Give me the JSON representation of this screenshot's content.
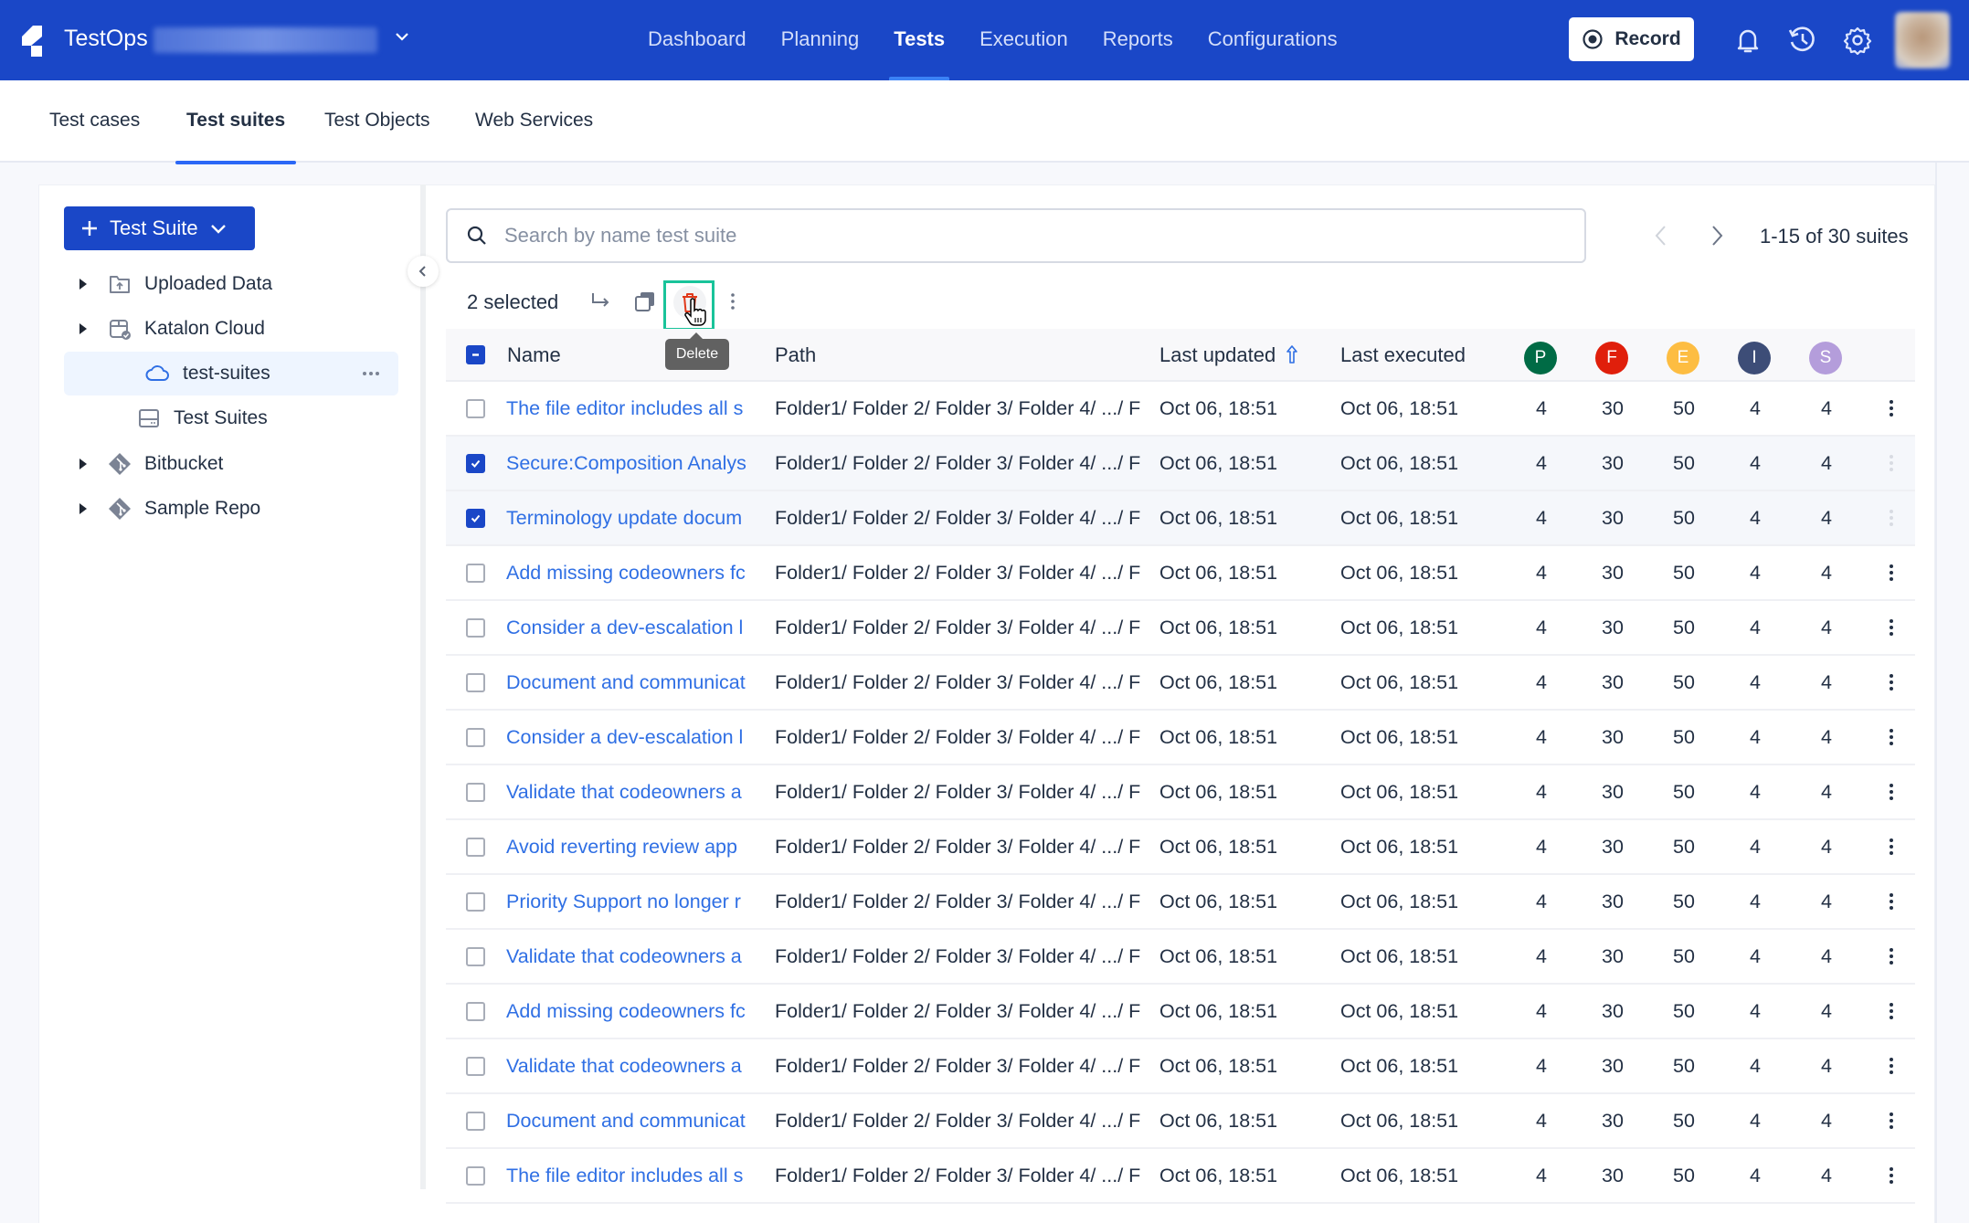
{
  "header": {
    "brand": "TestOps",
    "nav": [
      {
        "label": "Dashboard",
        "active": false
      },
      {
        "label": "Planning",
        "active": false
      },
      {
        "label": "Tests",
        "active": true
      },
      {
        "label": "Execution",
        "active": false
      },
      {
        "label": "Reports",
        "active": false
      },
      {
        "label": "Configurations",
        "active": false
      }
    ],
    "record_label": "Record"
  },
  "subtabs": [
    {
      "label": "Test cases",
      "active": false
    },
    {
      "label": "Test suites",
      "active": true
    },
    {
      "label": "Test Objects",
      "active": false
    },
    {
      "label": "Web Services",
      "active": false
    }
  ],
  "sidebar": {
    "new_button_label": "Test Suite",
    "tree": [
      {
        "label": "Uploaded Data",
        "icon": "folder-upload-icon",
        "level": 0,
        "expandable": true
      },
      {
        "label": "Katalon Cloud",
        "icon": "cloud-storage-icon",
        "level": 0,
        "expandable": true
      },
      {
        "label": "test-suites",
        "icon": "cloud-icon",
        "level": 1,
        "selected": true
      },
      {
        "label": "Test Suites",
        "icon": "drive-icon",
        "level": 1
      },
      {
        "label": "Bitbucket",
        "icon": "git-icon",
        "level": 0,
        "expandable": true
      },
      {
        "label": "Sample Repo",
        "icon": "git-icon",
        "level": 0,
        "expandable": true
      }
    ]
  },
  "search": {
    "placeholder": "Search by name test suite",
    "value": ""
  },
  "pager": {
    "text": "1-15 of 30 suites"
  },
  "toolbar": {
    "selected_text": "2 selected",
    "delete_tooltip": "Delete"
  },
  "table": {
    "columns": {
      "name": "Name",
      "path": "Path",
      "last_updated": "Last updated",
      "last_executed": "Last executed"
    },
    "status_columns": [
      {
        "letter": "P",
        "color": "#006b45"
      },
      {
        "letter": "F",
        "color": "#e01f0b"
      },
      {
        "letter": "E",
        "color": "#fdbd42"
      },
      {
        "letter": "I",
        "color": "#3d4d77"
      },
      {
        "letter": "S",
        "color": "#b49ddb"
      }
    ],
    "rows": [
      {
        "name": "The file editor includes all s",
        "path": "Folder1/ Folder 2/ Folder 3/ Folder 4/ .../ F",
        "updated": "Oct 06, 18:51",
        "executed": "Oct 06, 18:51",
        "p": "4",
        "f": "30",
        "e": "50",
        "i": "4",
        "s": "4",
        "checked": false
      },
      {
        "name": "Secure:Composition Analys",
        "path": "Folder1/ Folder 2/ Folder 3/ Folder 4/ .../ F",
        "updated": "Oct 06, 18:51",
        "executed": "Oct 06, 18:51",
        "p": "4",
        "f": "30",
        "e": "50",
        "i": "4",
        "s": "4",
        "checked": true
      },
      {
        "name": "Terminology update docum",
        "path": "Folder1/ Folder 2/ Folder 3/ Folder 4/ .../ F",
        "updated": "Oct 06, 18:51",
        "executed": "Oct 06, 18:51",
        "p": "4",
        "f": "30",
        "e": "50",
        "i": "4",
        "s": "4",
        "checked": true
      },
      {
        "name": "Add missing codeowners fc",
        "path": "Folder1/ Folder 2/ Folder 3/ Folder 4/ .../ F",
        "updated": "Oct 06, 18:51",
        "executed": "Oct 06, 18:51",
        "p": "4",
        "f": "30",
        "e": "50",
        "i": "4",
        "s": "4",
        "checked": false
      },
      {
        "name": "Consider a dev-escalation l",
        "path": "Folder1/ Folder 2/ Folder 3/ Folder 4/ .../ F",
        "updated": "Oct 06, 18:51",
        "executed": "Oct 06, 18:51",
        "p": "4",
        "f": "30",
        "e": "50",
        "i": "4",
        "s": "4",
        "checked": false
      },
      {
        "name": "Document and communicat",
        "path": "Folder1/ Folder 2/ Folder 3/ Folder 4/ .../ F",
        "updated": "Oct 06, 18:51",
        "executed": "Oct 06, 18:51",
        "p": "4",
        "f": "30",
        "e": "50",
        "i": "4",
        "s": "4",
        "checked": false
      },
      {
        "name": "Consider a dev-escalation l",
        "path": "Folder1/ Folder 2/ Folder 3/ Folder 4/ .../ F",
        "updated": "Oct 06, 18:51",
        "executed": "Oct 06, 18:51",
        "p": "4",
        "f": "30",
        "e": "50",
        "i": "4",
        "s": "4",
        "checked": false
      },
      {
        "name": "Validate that codeowners a",
        "path": "Folder1/ Folder 2/ Folder 3/ Folder 4/ .../ F",
        "updated": "Oct 06, 18:51",
        "executed": "Oct 06, 18:51",
        "p": "4",
        "f": "30",
        "e": "50",
        "i": "4",
        "s": "4",
        "checked": false
      },
      {
        "name": "Avoid reverting review app",
        "path": "Folder1/ Folder 2/ Folder 3/ Folder 4/ .../ F",
        "updated": "Oct 06, 18:51",
        "executed": "Oct 06, 18:51",
        "p": "4",
        "f": "30",
        "e": "50",
        "i": "4",
        "s": "4",
        "checked": false
      },
      {
        "name": "Priority Support no longer r",
        "path": "Folder1/ Folder 2/ Folder 3/ Folder 4/ .../ F",
        "updated": "Oct 06, 18:51",
        "executed": "Oct 06, 18:51",
        "p": "4",
        "f": "30",
        "e": "50",
        "i": "4",
        "s": "4",
        "checked": false
      },
      {
        "name": "Validate that codeowners a",
        "path": "Folder1/ Folder 2/ Folder 3/ Folder 4/ .../ F",
        "updated": "Oct 06, 18:51",
        "executed": "Oct 06, 18:51",
        "p": "4",
        "f": "30",
        "e": "50",
        "i": "4",
        "s": "4",
        "checked": false
      },
      {
        "name": "Add missing codeowners fc",
        "path": "Folder1/ Folder 2/ Folder 3/ Folder 4/ .../ F",
        "updated": "Oct 06, 18:51",
        "executed": "Oct 06, 18:51",
        "p": "4",
        "f": "30",
        "e": "50",
        "i": "4",
        "s": "4",
        "checked": false
      },
      {
        "name": "Validate that codeowners a",
        "path": "Folder1/ Folder 2/ Folder 3/ Folder 4/ .../ F",
        "updated": "Oct 06, 18:51",
        "executed": "Oct 06, 18:51",
        "p": "4",
        "f": "30",
        "e": "50",
        "i": "4",
        "s": "4",
        "checked": false
      },
      {
        "name": "Document and communicat",
        "path": "Folder1/ Folder 2/ Folder 3/ Folder 4/ .../ F",
        "updated": "Oct 06, 18:51",
        "executed": "Oct 06, 18:51",
        "p": "4",
        "f": "30",
        "e": "50",
        "i": "4",
        "s": "4",
        "checked": false
      },
      {
        "name": "The file editor includes all s",
        "path": "Folder1/ Folder 2/ Folder 3/ Folder 4/ .../ F",
        "updated": "Oct 06, 18:51",
        "executed": "Oct 06, 18:51",
        "p": "4",
        "f": "30",
        "e": "50",
        "i": "4",
        "s": "4",
        "checked": false
      }
    ]
  }
}
